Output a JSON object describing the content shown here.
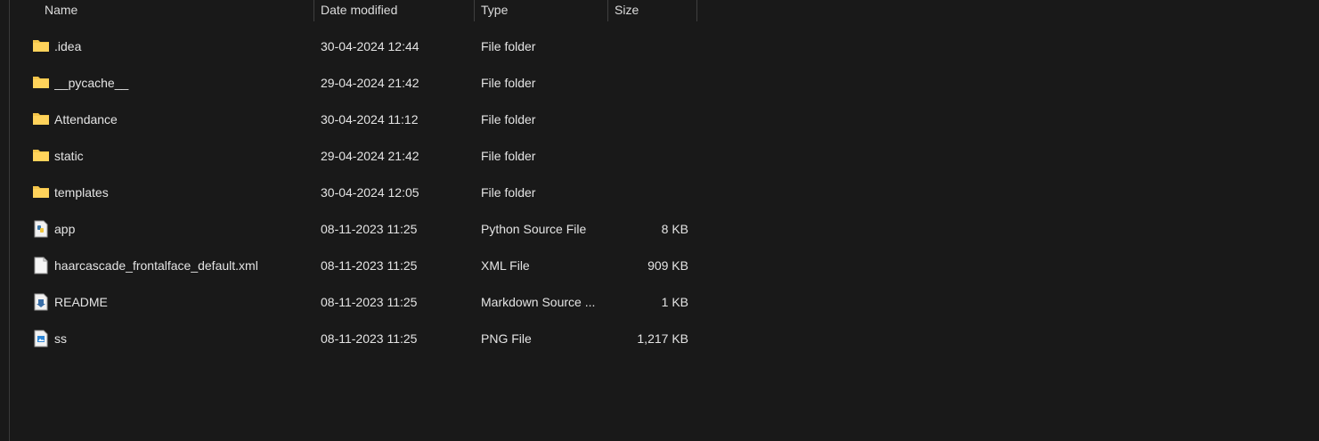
{
  "columns": {
    "name": "Name",
    "date": "Date modified",
    "type": "Type",
    "size": "Size"
  },
  "files": [
    {
      "name": ".idea",
      "date": "30-04-2024 12:44",
      "type": "File folder",
      "size": "",
      "icon": "folder-icon"
    },
    {
      "name": "__pycache__",
      "date": "29-04-2024 21:42",
      "type": "File folder",
      "size": "",
      "icon": "folder-icon"
    },
    {
      "name": "Attendance",
      "date": "30-04-2024 11:12",
      "type": "File folder",
      "size": "",
      "icon": "folder-icon"
    },
    {
      "name": "static",
      "date": "29-04-2024 21:42",
      "type": "File folder",
      "size": "",
      "icon": "folder-icon"
    },
    {
      "name": "templates",
      "date": "30-04-2024 12:05",
      "type": "File folder",
      "size": "",
      "icon": "folder-icon"
    },
    {
      "name": "app",
      "date": "08-11-2023 11:25",
      "type": "Python Source File",
      "size": "8 KB",
      "icon": "python-file-icon"
    },
    {
      "name": "haarcascade_frontalface_default.xml",
      "date": "08-11-2023 11:25",
      "type": "XML File",
      "size": "909 KB",
      "icon": "blank-file-icon"
    },
    {
      "name": "README",
      "date": "08-11-2023 11:25",
      "type": "Markdown Source ...",
      "size": "1 KB",
      "icon": "markdown-file-icon"
    },
    {
      "name": "ss",
      "date": "08-11-2023 11:25",
      "type": "PNG File",
      "size": "1,217 KB",
      "icon": "image-file-icon"
    }
  ],
  "colors": {
    "background": "#191919",
    "folder": "#f4c54a",
    "text": "#e4e4e4"
  }
}
